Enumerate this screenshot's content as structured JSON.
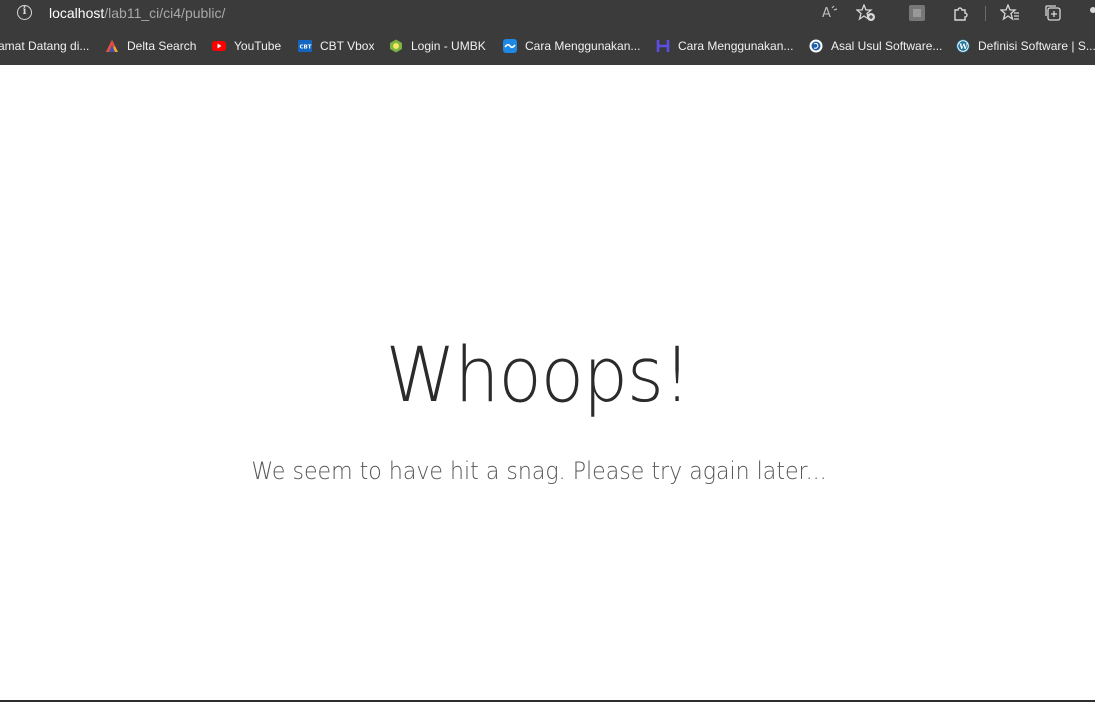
{
  "address_bar": {
    "url_host": "localhost",
    "url_path": "/lab11_ci/ci4/public/"
  },
  "toolbar": {
    "icons": [
      "read-aloud-icon",
      "add-favorite-icon",
      "profile-icon",
      "extensions-icon",
      "favorites-icon",
      "collections-icon"
    ]
  },
  "bookmarks": [
    {
      "label": "amat Datang di...",
      "icon": "globe-icon",
      "color": "#3b3b3b"
    },
    {
      "label": "Delta Search",
      "icon": "delta-icon",
      "color": "#e84c3d"
    },
    {
      "label": "YouTube",
      "icon": "youtube-icon",
      "color": "#ff0000"
    },
    {
      "label": "CBT Vbox",
      "icon": "cbt-icon",
      "color": "#1565c0"
    },
    {
      "label": "Login - UMBK",
      "icon": "umbk-icon",
      "color": "#7cb342"
    },
    {
      "label": "Cara Menggunakan...",
      "icon": "zoom-icon",
      "color": "#1e88e5"
    },
    {
      "label": "Cara Menggunakan...",
      "icon": "h-icon",
      "color": "#5c4ee5"
    },
    {
      "label": "Asal Usul Software...",
      "icon": "site-icon",
      "color": "#1f5fa8"
    },
    {
      "label": "Definisi Software | S...",
      "icon": "wordpress-icon",
      "color": "#21759b"
    }
  ],
  "page": {
    "headline": "Whoops!",
    "message": "We seem to have hit a snag. Please try again later..."
  }
}
